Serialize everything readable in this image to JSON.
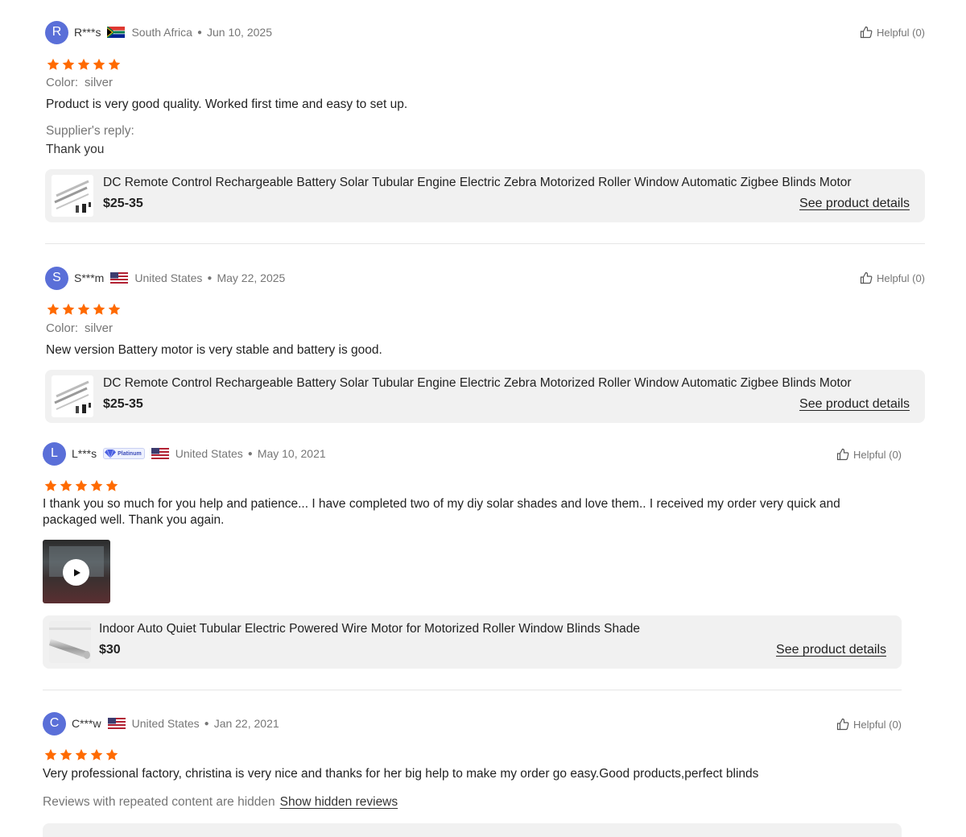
{
  "reviews": [
    {
      "initial": "R",
      "name": "R***s",
      "country": "South Africa",
      "date": "Jun 10, 2025",
      "helpful": "Helpful (0)",
      "rating": 5,
      "variant_label": "Color:",
      "variant_value": "silver",
      "text": "Product is very good quality. Worked first time and easy to set up.",
      "reply_label": "Supplier's reply:",
      "reply_text": "Thank you",
      "product": {
        "title": "DC Remote Control Rechargeable Battery Solar Tubular Engine Electric Zebra Motorized Roller Window Automatic Zigbee Blinds Motor",
        "price": "$25-35",
        "link": "See product details"
      }
    },
    {
      "initial": "S",
      "name": "S***m",
      "country": "United States",
      "date": "May 22, 2025",
      "helpful": "Helpful (0)",
      "rating": 5,
      "variant_label": "Color:",
      "variant_value": "silver",
      "text": "New version Battery motor is very stable and battery is good.",
      "product": {
        "title": "DC Remote Control Rechargeable Battery Solar Tubular Engine Electric Zebra Motorized Roller Window Automatic Zigbee Blinds Motor",
        "price": "$25-35",
        "link": "See product details"
      }
    },
    {
      "initial": "L",
      "name": "L***s",
      "badge": "Platinum",
      "country": "United States",
      "date": "May 10, 2021",
      "helpful": "Helpful (0)",
      "rating": 5,
      "text": "I thank you so much for you help and patience... I have completed two of my diy solar shades and love them.. I received my order very quick and packaged well. Thank you again.",
      "product": {
        "title": "Indoor Auto Quiet Tubular Electric Powered Wire Motor for Motorized Roller Window Blinds Shade",
        "price": "$30",
        "link": "See product details"
      }
    },
    {
      "initial": "C",
      "name": "C***w",
      "country": "United States",
      "date": "Jan 22, 2021",
      "helpful": "Helpful (0)",
      "rating": 5,
      "text": "Very professional factory, christina is very nice and thanks for her big help to make my order go easy.Good products,perfect blinds"
    }
  ],
  "hidden_note": "Reviews with repeated content are hidden",
  "hidden_link": "Show hidden reviews",
  "colors": {
    "star": "#ff6a00",
    "avatar": "#5a6fd8",
    "muted": "#767676",
    "product_bg": "#f1f1f1"
  }
}
